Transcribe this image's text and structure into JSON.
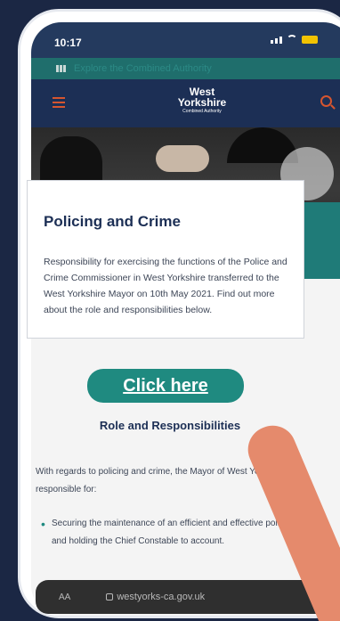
{
  "status_bar": {
    "time": "10:17"
  },
  "top_bar": {
    "label": "Explore the Combined Authority"
  },
  "logo": {
    "line1": "West",
    "line2": "Yorkshire",
    "line3": "Combined Authority"
  },
  "card": {
    "title": "Policing and Crime",
    "text": "Responsibility for exercising the functions of the Police and Crime Commissioner in West Yorkshire transferred to the West Yorkshire Mayor on 10th May 2021. Find out more about the role and responsibilities below."
  },
  "cta": {
    "label": "Click here"
  },
  "section": {
    "title": "Role and Responsibilities",
    "intro": "With regards to policing and crime, the Mayor of West Yorkshire is responsible for:",
    "bullet1": "Securing the maintenance of an efficient and effective police force and holding the Chief Constable to account."
  },
  "browser": {
    "aa": "AA",
    "url": "westyorks-ca.gov.uk"
  },
  "colors": {
    "background": "#1b2744",
    "teal": "#1f8a80",
    "pointer": "#e58a6c"
  }
}
